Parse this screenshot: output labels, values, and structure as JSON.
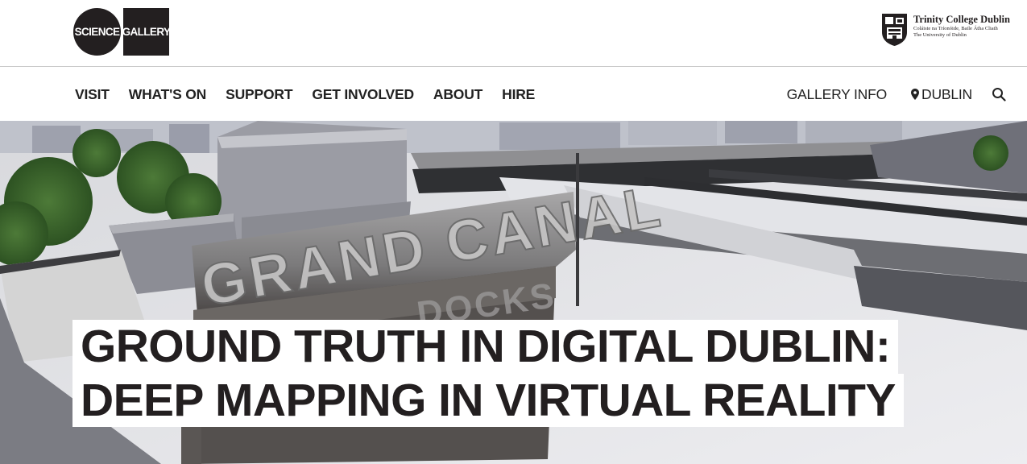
{
  "logo": {
    "circle_text": "SCIENCE",
    "square_text": "GALLERY"
  },
  "tcd": {
    "name": "Trinity College Dublin",
    "irish": "Coláiste na Tríonóide, Baile Átha Cliath",
    "university": "The University of Dublin"
  },
  "nav": {
    "items": [
      {
        "label": "VISIT"
      },
      {
        "label": "WHAT'S ON"
      },
      {
        "label": "SUPPORT"
      },
      {
        "label": "GET INVOLVED"
      },
      {
        "label": "ABOUT"
      },
      {
        "label": "HIRE"
      }
    ],
    "gallery_info": "GALLERY INFO",
    "location": "DUBLIN",
    "icons": {
      "location": "map-pin-icon",
      "search": "search-icon"
    }
  },
  "hero": {
    "title_line1": "GROUND TRUTH IN DIGITAL DUBLIN:",
    "title_line2": "DEEP MAPPING IN VIRTUAL REALITY"
  }
}
